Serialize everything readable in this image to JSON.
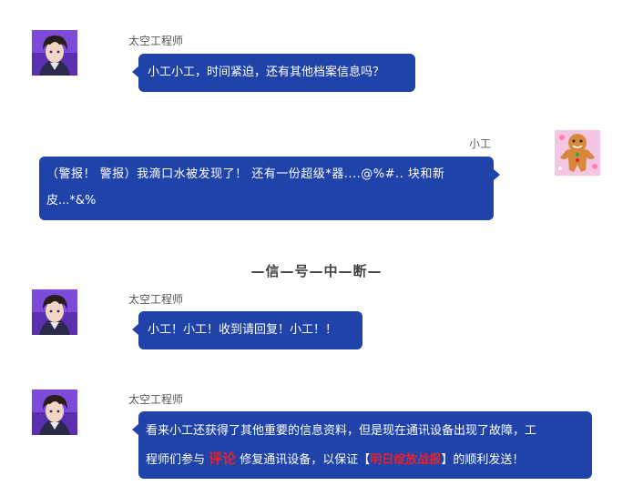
{
  "chat": {
    "messages": [
      {
        "sender": "太空工程师",
        "text": "小工小工，时间紧迫，还有其他档案信息吗？"
      },
      {
        "sender": "小工",
        "text_line1": "（警报！ 警报）我滴口水被发现了！ 还有一份超级*器....@%#.. 块和新",
        "text_line2": "皮...*&%"
      },
      {
        "sender": "太空工程师",
        "text": "小工！小工！收到请回复！小工！！"
      },
      {
        "sender": "太空工程师",
        "text_line1": "看来小工还获得了其他重要的信息资料，但是现在通讯设备出现了故障，工",
        "text_line2_pre": "程师们参与 ",
        "text_line2_highlight": "评论",
        "text_line2_mid": " 修复通讯设备，以保证【",
        "text_line2_report": "明日绽放战报",
        "text_line2_post": "】的顺利发送！"
      }
    ],
    "divider": "—信—号—中—断—"
  },
  "colors": {
    "bubble": "#1f43a8",
    "highlight": "#e8222b"
  },
  "icons": {
    "engineer_avatar": "anime-engineer-avatar-icon",
    "xiaogong_avatar": "gingerbread-avatar-icon"
  }
}
